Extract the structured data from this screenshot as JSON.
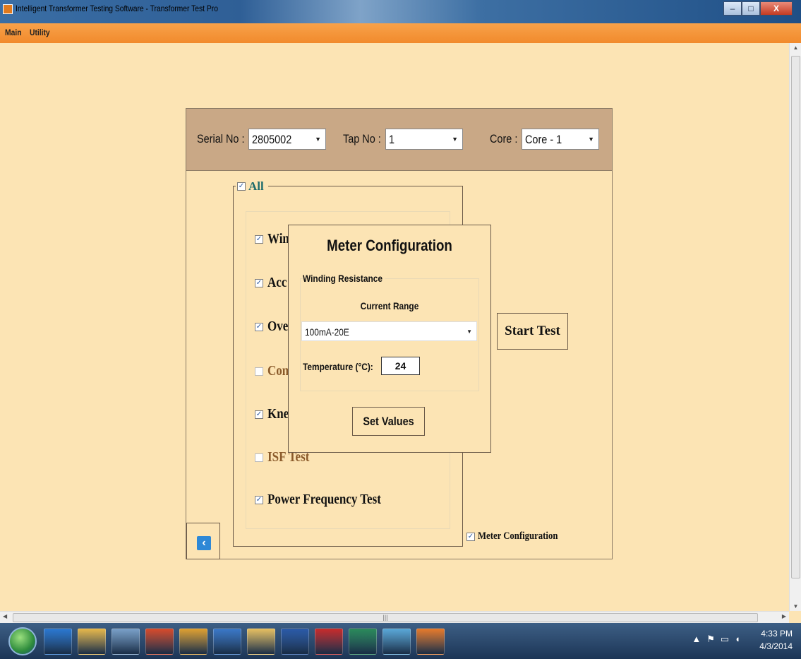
{
  "window": {
    "title": "Intelligent Transformer Testing Software - Transformer Test Pro",
    "buttons": [
      "–",
      "□",
      "X"
    ]
  },
  "menu": {
    "items": [
      "Main",
      "Utility"
    ]
  },
  "header": {
    "serial_label": "Serial No :",
    "serial_value": "2805002",
    "tap_label": "Tap No :",
    "tap_value": "1",
    "core_label": "Core :",
    "core_value": "Core - 1"
  },
  "tests": {
    "all_label": "All",
    "all_checked": true,
    "items": [
      {
        "label": "Win",
        "checked": true
      },
      {
        "label": "Acc",
        "checked": true
      },
      {
        "label": "Ove",
        "checked": true
      },
      {
        "label": "Com",
        "checked": false
      },
      {
        "label": "Kne",
        "checked": true
      },
      {
        "label": "ISF Test",
        "checked": false
      },
      {
        "label": "Power Frequency Test",
        "checked": true
      }
    ]
  },
  "actions": {
    "start_test": "Start Test",
    "meter_config_label": "Meter Configuration",
    "meter_config_checked": true
  },
  "dialog": {
    "title": "Meter Configuration",
    "group_label": "Winding Resistance",
    "current_range_label": "Current Range",
    "current_range_value": "100mA-20E",
    "temperature_label": "Temperature (°C):",
    "temperature_value": "24",
    "set_values": "Set Values"
  },
  "taskbar": {
    "time": "4:33 PM",
    "date": "4/3/2014",
    "apps": [
      "ie",
      "explorer",
      "tools",
      "chrome",
      "app",
      "media",
      "folder",
      "word",
      "acrobat",
      "app2",
      "app3",
      "app4"
    ],
    "colors": [
      "#2a78d2",
      "#e8b84a",
      "#7aa0c8",
      "#d84a2a",
      "#e0a030",
      "#3a78c8",
      "#e8c060",
      "#2a5aa8",
      "#c82a2a",
      "#2a8a5a",
      "#5aa8d8",
      "#e87a2a"
    ]
  }
}
